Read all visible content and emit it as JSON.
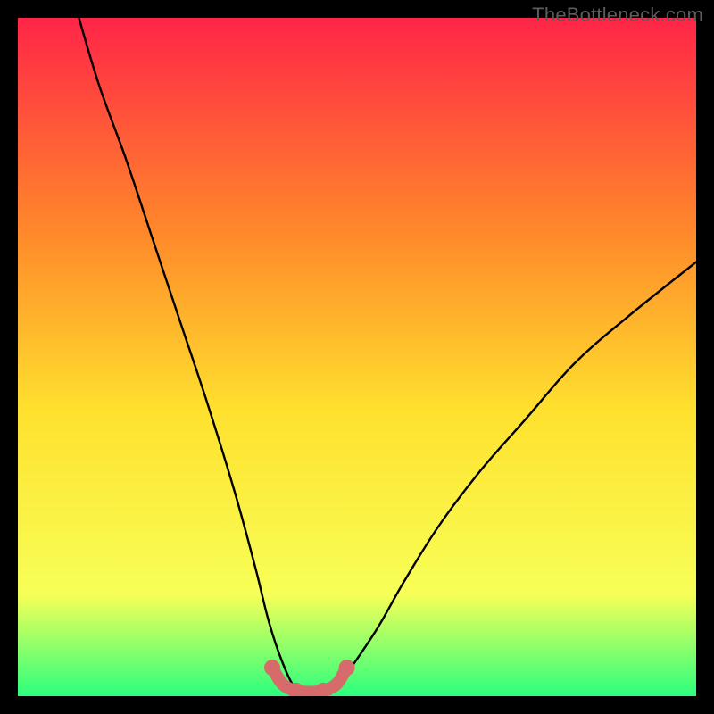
{
  "watermark": "TheBottleneck.com",
  "colors": {
    "frame": "#000000",
    "gradient_top": "#ff2547",
    "gradient_mid1": "#ff8a2a",
    "gradient_mid2": "#ffe12e",
    "gradient_mid3": "#f7ff57",
    "gradient_bottom": "#2aff7d",
    "curve": "#000000",
    "highlight": "#d76a6a"
  },
  "chart_data": {
    "type": "line",
    "title": "",
    "xlabel": "",
    "ylabel": "",
    "xlim": [
      0,
      100
    ],
    "ylim": [
      0,
      100
    ],
    "series": [
      {
        "name": "bottleneck-curve",
        "x": [
          9,
          12,
          16,
          20,
          24,
          28,
          32,
          35,
          37,
          39,
          41,
          43,
          45,
          47,
          49,
          53,
          57,
          62,
          68,
          75,
          82,
          90,
          100
        ],
        "y": [
          100,
          90,
          79,
          67,
          55,
          43,
          30,
          19,
          11,
          5,
          1,
          0,
          0,
          1,
          4,
          10,
          17,
          25,
          33,
          41,
          49,
          56,
          64
        ]
      },
      {
        "name": "salmon-highlight",
        "x": [
          37.5,
          39,
          41,
          43,
          45,
          47,
          48.5
        ],
        "y": [
          4.2,
          1.8,
          0.8,
          0.6,
          0.8,
          1.8,
          4.2
        ]
      }
    ],
    "annotations": []
  }
}
